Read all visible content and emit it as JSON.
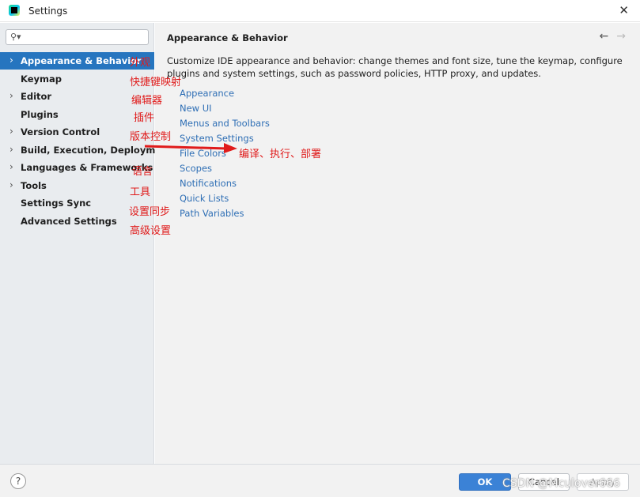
{
  "window": {
    "title": "Settings",
    "icon": "intellij-app-icon"
  },
  "search": {
    "value": "",
    "placeholder": ""
  },
  "sidebar": {
    "items": [
      {
        "label": "Appearance & Behavior",
        "expandable": true,
        "selected": true
      },
      {
        "label": "Keymap",
        "expandable": false,
        "selected": false
      },
      {
        "label": "Editor",
        "expandable": true,
        "selected": false
      },
      {
        "label": "Plugins",
        "expandable": false,
        "selected": false
      },
      {
        "label": "Version Control",
        "expandable": true,
        "selected": false
      },
      {
        "label": "Build, Execution, Deployment",
        "expandable": true,
        "selected": false
      },
      {
        "label": "Languages & Frameworks",
        "expandable": true,
        "selected": false
      },
      {
        "label": "Tools",
        "expandable": true,
        "selected": false
      },
      {
        "label": "Settings Sync",
        "expandable": false,
        "selected": false
      },
      {
        "label": "Advanced Settings",
        "expandable": false,
        "selected": false
      }
    ]
  },
  "annotations": [
    "外观",
    "快捷键映射",
    "编辑器",
    "插件",
    "版本控制",
    "编译、执行、部署",
    "语言",
    "工具",
    "设置同步",
    "高级设置"
  ],
  "main": {
    "title": "Appearance & Behavior",
    "description": "Customize IDE appearance and behavior: change themes and font size, tune the keymap, configure plugins and system settings, such as password policies, HTTP proxy, and updates.",
    "links": [
      "Appearance",
      "New UI",
      "Menus and Toolbars",
      "System Settings",
      "File Colors",
      "Scopes",
      "Notifications",
      "Quick Lists",
      "Path Variables"
    ]
  },
  "footer": {
    "help": "?",
    "ok": "OK",
    "cancel": "Cancel",
    "apply": "Apply",
    "watermark": "CSDN @Mculover666"
  },
  "colors": {
    "accent": "#2675bf",
    "link": "#2f6fb5",
    "annotation": "#e01b1b",
    "ok_button": "#3b82d6"
  }
}
